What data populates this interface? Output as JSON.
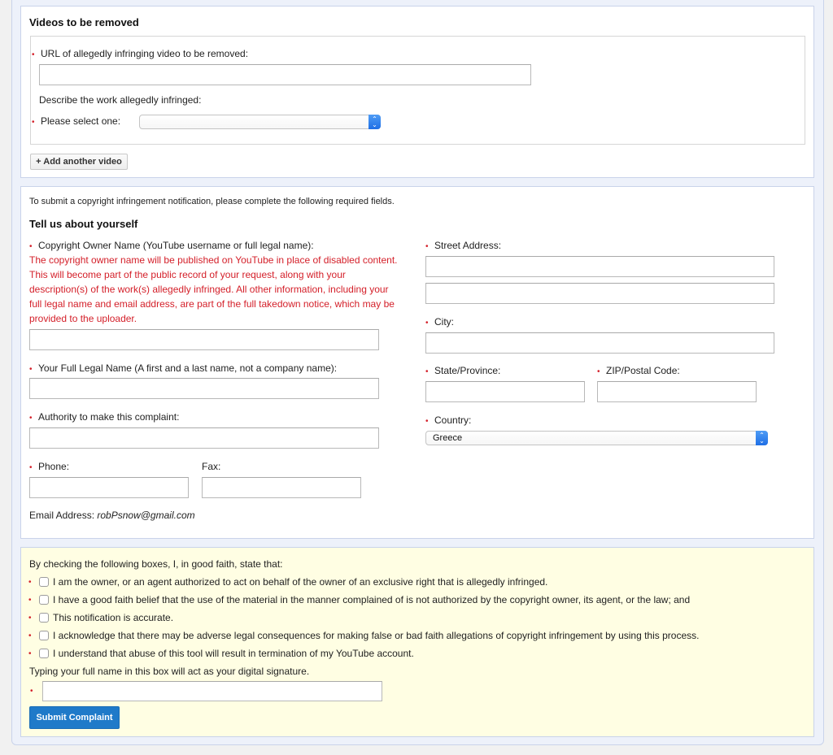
{
  "videos_section": {
    "title": "Videos to be removed",
    "url_label": "URL of allegedly infringing video to be removed:",
    "url_value": "",
    "describe_label": "Describe the work allegedly infringed:",
    "select_label": "Please select one:",
    "select_value": "",
    "add_button": "+ Add another video"
  },
  "about_section": {
    "intro": "To submit a copyright infringement notification, please complete the following required fields.",
    "title": "Tell us about yourself",
    "owner_name_label": "Copyright Owner Name (YouTube username or full legal name):",
    "owner_name_notice": "The copyright owner name will be published on YouTube in place of disabled content. This will become part of the public record of your request, along with your description(s) of the work(s) allegedly infringed. All other information, including your full legal name and email address, are part of the full takedown notice, which may be provided to the uploader.",
    "owner_name_value": "",
    "full_legal_name_label": "Your Full Legal Name (A first and a last name, not a company name):",
    "full_legal_name_value": "",
    "authority_label": "Authority to make this complaint:",
    "authority_value": "",
    "phone_label": "Phone:",
    "phone_value": "",
    "fax_label": "Fax:",
    "fax_value": "",
    "email_label": "Email Address:",
    "email_value": "robPsnow@gmail.com",
    "street_label": "Street Address:",
    "street_value_1": "",
    "street_value_2": "",
    "city_label": "City:",
    "city_value": "",
    "state_label": "State/Province:",
    "state_value": "",
    "zip_label": "ZIP/Postal Code:",
    "zip_value": "",
    "country_label": "Country:",
    "country_value": "Greece"
  },
  "affirmation_section": {
    "intro": "By checking the following boxes, I, in good faith, state that:",
    "checkboxes": [
      {
        "label": "I am the owner, or an agent authorized to act on behalf of the owner of an exclusive right that is allegedly infringed.",
        "checked": false
      },
      {
        "label": "I have a good faith belief that the use of the material in the manner complained of is not authorized by the copyright owner, its agent, or the law; and",
        "checked": false
      },
      {
        "label": "This notification is accurate.",
        "checked": false
      },
      {
        "label": "I acknowledge that there may be adverse legal consequences for making false or bad faith allegations of copyright infringement by using this process.",
        "checked": false
      },
      {
        "label": "I understand that abuse of this tool will result in termination of my YouTube account.",
        "checked": false
      }
    ],
    "signature_label": "Typing your full name in this box will act as your digital signature.",
    "signature_value": "",
    "submit_button": "Submit Complaint"
  },
  "icons": {
    "required_marker": "•",
    "select_arrows": "⌃⌄"
  },
  "colors": {
    "required_red": "#d4202a",
    "submit_blue": "#1f7ac9",
    "affirmation_bg": "#fffee3",
    "frame_bg": "#edf1fa"
  }
}
